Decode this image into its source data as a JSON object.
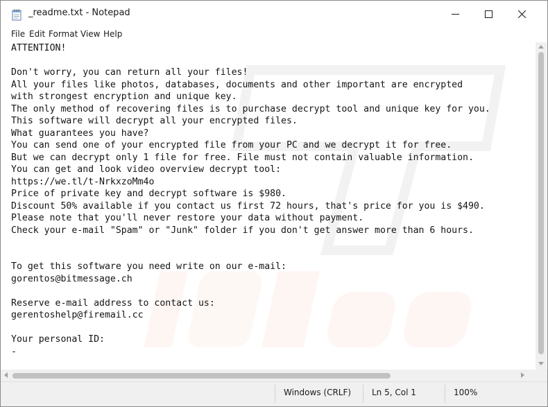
{
  "window": {
    "title": "_readme.txt - Notepad"
  },
  "menu": {
    "file": "File",
    "edit": "Edit",
    "format": "Format",
    "view": "View",
    "help": "Help"
  },
  "document": {
    "lines": [
      "ATTENTION!",
      "",
      "Don't worry, you can return all your files!",
      "All your files like photos, databases, documents and other important are encrypted",
      "with strongest encryption and unique key.",
      "The only method of recovering files is to purchase decrypt tool and unique key for you.",
      "This software will decrypt all your encrypted files.",
      "What guarantees you have?",
      "You can send one of your encrypted file from your PC and we decrypt it for free.",
      "But we can decrypt only 1 file for free. File must not contain valuable information.",
      "You can get and look video overview decrypt tool:",
      "https://we.tl/t-NrkxzoMm4o",
      "Price of private key and decrypt software is $980.",
      "Discount 50% available if you contact us first 72 hours, that's price for you is $490.",
      "Please note that you'll never restore your data without payment.",
      "Check your e-mail \"Spam\" or \"Junk\" folder if you don't get answer more than 6 hours.",
      "",
      "",
      "To get this software you need write on our e-mail:",
      "gorentos@bitmessage.ch",
      "",
      "Reserve e-mail address to contact us:",
      "gerentoshelp@firemail.cc",
      "",
      "Your personal ID:",
      "-"
    ]
  },
  "status": {
    "encoding": "Windows (CRLF)",
    "position": "Ln 5, Col 1",
    "zoom": "100%"
  },
  "colors": {
    "watermark": "#f5a97f",
    "chrome": "#f0f0f0",
    "text": "#141414"
  },
  "icons": {
    "app": "notepad-icon",
    "minimize": "minimize-icon",
    "maximize": "maximize-icon",
    "close": "close-icon"
  }
}
